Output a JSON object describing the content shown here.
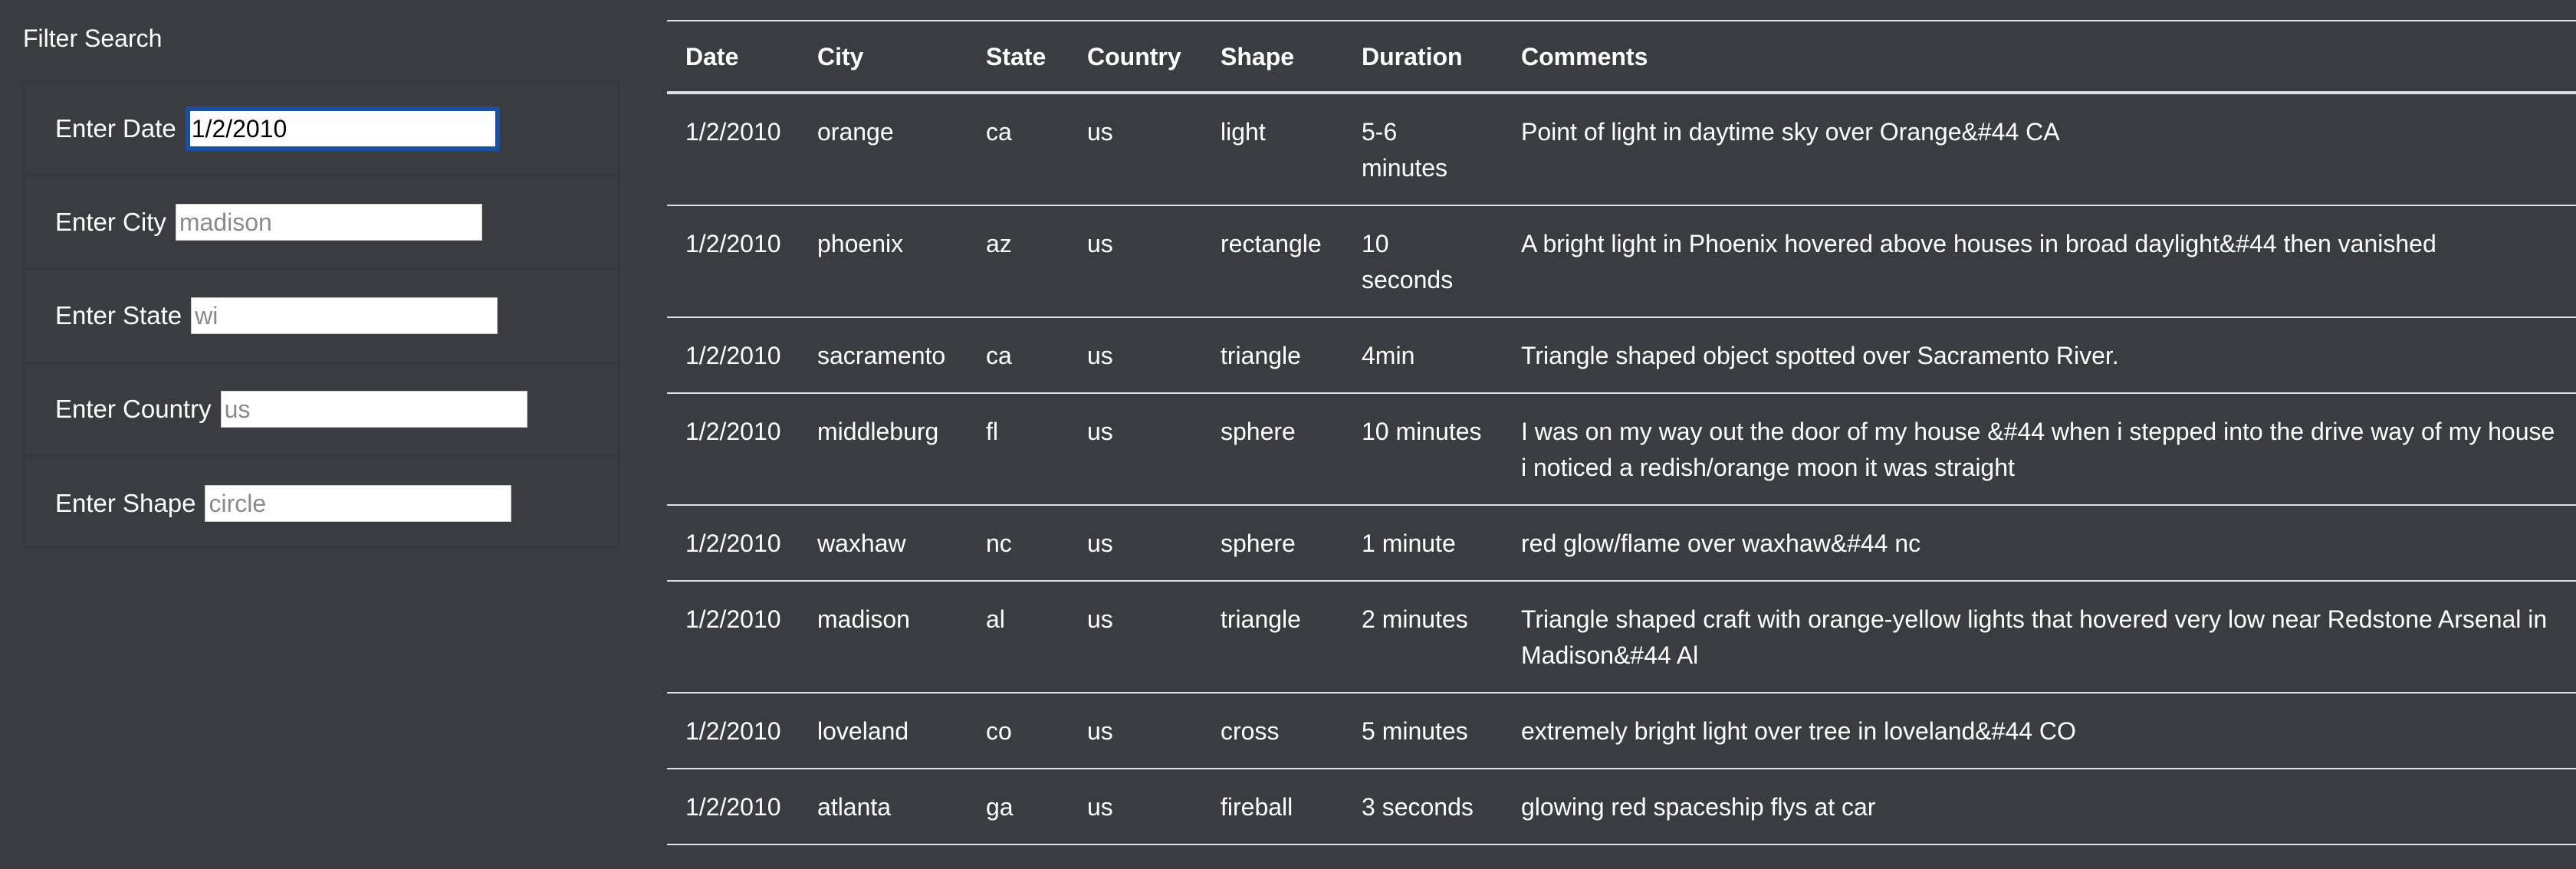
{
  "sidebar": {
    "title": "Filter Search",
    "filters": [
      {
        "label": "Enter Date",
        "value": "1/2/2010",
        "placeholder": ""
      },
      {
        "label": "Enter City",
        "value": "",
        "placeholder": "madison"
      },
      {
        "label": "Enter State",
        "value": "",
        "placeholder": "wi"
      },
      {
        "label": "Enter Country",
        "value": "",
        "placeholder": "us"
      },
      {
        "label": "Enter Shape",
        "value": "",
        "placeholder": "circle"
      }
    ]
  },
  "table": {
    "headers": [
      "Date",
      "City",
      "State",
      "Country",
      "Shape",
      "Duration",
      "Comments"
    ],
    "rows": [
      [
        "1/2/2010",
        "orange",
        "ca",
        "us",
        "light",
        "5-6 minutes",
        "Point of light in daytime sky over Orange&#44 CA"
      ],
      [
        "1/2/2010",
        "phoenix",
        "az",
        "us",
        "rectangle",
        "10 seconds",
        "A bright light in Phoenix hovered above houses in broad daylight&#44 then vanished"
      ],
      [
        "1/2/2010",
        "sacramento",
        "ca",
        "us",
        "triangle",
        "4min",
        "Triangle shaped object spotted over Sacramento River."
      ],
      [
        "1/2/2010",
        "middleburg",
        "fl",
        "us",
        "sphere",
        "10 minutes",
        "I was on my way out the door of my house &#44 when i stepped into the drive way of my house i noticed a redish/orange moon it was straight"
      ],
      [
        "1/2/2010",
        "waxhaw",
        "nc",
        "us",
        "sphere",
        "1 minute",
        "red glow/flame over waxhaw&#44 nc"
      ],
      [
        "1/2/2010",
        "madison",
        "al",
        "us",
        "triangle",
        "2 minutes",
        "Triangle shaped craft with orange-yellow lights that hovered very low near Redstone Arsenal in Madison&#44 Al"
      ],
      [
        "1/2/2010",
        "loveland",
        "co",
        "us",
        "cross",
        "5 minutes",
        "extremely bright light over tree in loveland&#44 CO"
      ],
      [
        "1/2/2010",
        "atlanta",
        "ga",
        "us",
        "fireball",
        "3 seconds",
        "glowing red spaceship flys at car"
      ]
    ]
  },
  "colors": {
    "background": "#393d42",
    "text": "#ffffff",
    "focus_border": "#1a4fa0",
    "divider": "#dee2e6"
  }
}
